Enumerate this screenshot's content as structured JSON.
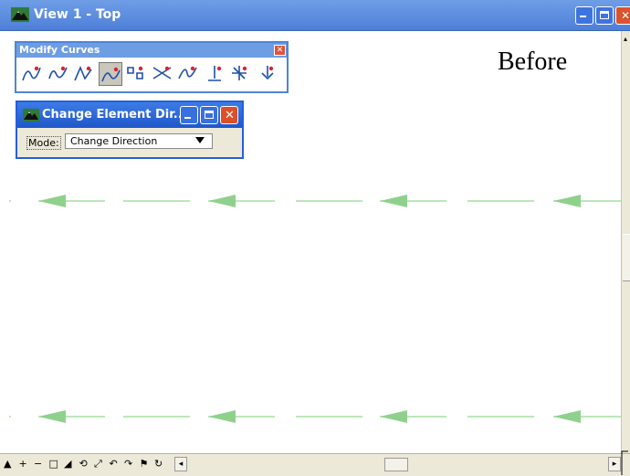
{
  "window": {
    "title": "View 1 - Top"
  },
  "annotation": "Before",
  "modify_curves": {
    "title": "Modify Curves",
    "tools": [
      {
        "name": "modify-curve-icon"
      },
      {
        "name": "insert-pi-icon"
      },
      {
        "name": "delete-pi-icon"
      },
      {
        "name": "change-element-direction-icon",
        "active": true
      },
      {
        "name": "extract-points-icon"
      },
      {
        "name": "intersect-icon"
      },
      {
        "name": "fillet-icon"
      },
      {
        "name": "perpendicular-icon"
      },
      {
        "name": "spiral-icon"
      },
      {
        "name": "extend-icon"
      }
    ]
  },
  "change_direction_dialog": {
    "title": "Change Element Dir...",
    "mode_label": "Mode:",
    "mode_value": "Change Direction"
  },
  "colors": {
    "arrow": "#8fd18c",
    "line": "#a5dfa2",
    "titlebar": "#5b8de0"
  },
  "bottom_toolbar": {
    "tools": [
      "view-attributes-icon",
      "zoom-in-icon",
      "zoom-out-icon",
      "window-area-icon",
      "fit-view-icon",
      "rotate-view-icon",
      "pan-view-icon",
      "view-previous-icon",
      "view-next-icon",
      "copy-view-icon",
      "update-view-icon"
    ]
  }
}
